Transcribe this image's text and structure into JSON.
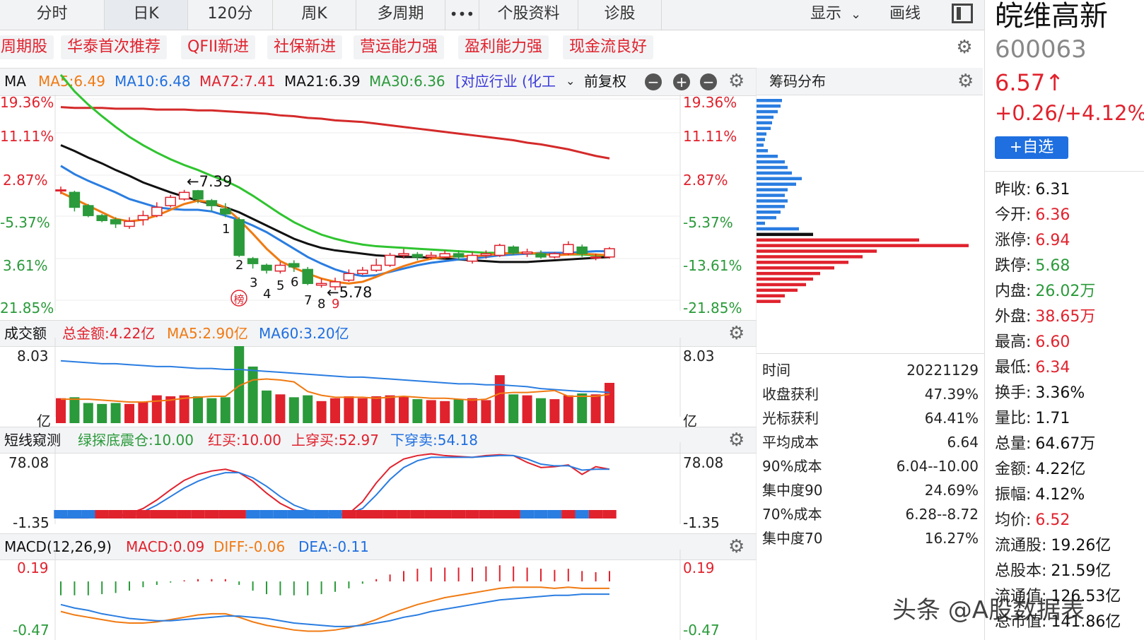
{
  "tabs": [
    "分时",
    "日K",
    "120分",
    "周K",
    "多周期",
    "•••",
    "个股资料",
    "诊股"
  ],
  "active_tab": "日K",
  "toolbar": {
    "show": "显示",
    "draw": "画线"
  },
  "tags": [
    "周期股",
    "华泰首次推荐",
    "QFII新进",
    "社保新进",
    "营运能力强",
    "盈利能力强",
    "现金流良好"
  ],
  "ma_header": {
    "label": "MA",
    "ma5": "MA5:6.49",
    "ma10": "MA10:6.48",
    "ma72": "MA72:7.41",
    "ma21": "MA21:6.39",
    "ma30": "MA30:6.36",
    "industry": "[对应行业 (化工",
    "adjust": "前复权"
  },
  "price_axis_left": [
    "19.36%",
    "11.11%",
    "2.87%",
    "-5.37%",
    "3.61%",
    "21.85%"
  ],
  "price_axis_right": [
    "19.36%",
    "11.11%",
    "2.87%",
    "-5.37%",
    "-13.61%",
    "-21.85%"
  ],
  "annotations": {
    "high": "←7.39",
    "low": "←5.78",
    "bang": "榜",
    "counts": [
      "1",
      "2",
      "3",
      "4",
      "5",
      "6",
      "7",
      "8",
      "9"
    ]
  },
  "volume_header": {
    "label": "成交额",
    "total": "总金额:4.22亿",
    "ma5": "MA5:2.90亿",
    "ma60": "MA60:3.20亿"
  },
  "volume_axis": {
    "top_left": "8.03",
    "bottom_left": "亿",
    "top_right": "8.03",
    "bottom_right": "亿"
  },
  "short_header": {
    "label": "短线窥测",
    "green": "绿探底震仓:10.00",
    "red": "红买:10.00",
    "up": "上穿买:52.97",
    "down": "下穿卖:54.18"
  },
  "short_axis": {
    "top_left": "78.08",
    "bottom_left": "-1.35",
    "top_right": "78.08",
    "bottom_right": "-1.35"
  },
  "macd_header": {
    "label": "MACD(12,26,9)",
    "macd": "MACD:0.09",
    "diff": "DIFF:-0.06",
    "dea": "DEA:-0.11"
  },
  "macd_axis": {
    "top_left": "0.19",
    "bottom_left": "-0.47",
    "top_right": "0.19",
    "bottom_right": "-0.47"
  },
  "chip": {
    "title": "筹码分布",
    "rows": [
      {
        "k": "时间",
        "v": "20221129"
      },
      {
        "k": "收盘获利",
        "v": "47.39%"
      },
      {
        "k": "光标获利",
        "v": "64.41%"
      },
      {
        "k": "平均成本",
        "v": "6.64"
      },
      {
        "k": "90%成本",
        "v": "6.04--10.00"
      },
      {
        "k": "集中度90",
        "v": "24.69%"
      },
      {
        "k": "70%成本",
        "v": "6.28--8.72"
      },
      {
        "k": "集中度70",
        "v": "16.27%"
      }
    ]
  },
  "quote": {
    "name": "皖维高新",
    "code": "600063",
    "price": "6.57↑",
    "change": "+0.26/+4.12%",
    "add_fav": "+自选",
    "rows": [
      {
        "k": "昨收:",
        "v": "6.31",
        "c": "black"
      },
      {
        "k": "今开:",
        "v": "6.36",
        "c": "red"
      },
      {
        "k": "涨停:",
        "v": "6.94",
        "c": "red"
      },
      {
        "k": "跌停:",
        "v": "5.68",
        "c": "green"
      },
      {
        "k": "内盘:",
        "v": "26.02万",
        "c": "green"
      },
      {
        "k": "外盘:",
        "v": "38.65万",
        "c": "red"
      },
      {
        "k": "最高:",
        "v": "6.60",
        "c": "red"
      },
      {
        "k": "最低:",
        "v": "6.34",
        "c": "red"
      },
      {
        "k": "换手:",
        "v": "3.36%",
        "c": "black"
      },
      {
        "k": "量比:",
        "v": "1.71",
        "c": "black"
      },
      {
        "k": "总量:",
        "v": "64.67万",
        "c": "black"
      },
      {
        "k": "金额:",
        "v": "4.22亿",
        "c": "black"
      },
      {
        "k": "振幅:",
        "v": "4.12%",
        "c": "black"
      },
      {
        "k": "均价:",
        "v": "6.52",
        "c": "red"
      },
      {
        "k": "流通股:",
        "v": "19.26亿",
        "c": "black"
      },
      {
        "k": "总股本:",
        "v": "21.59亿",
        "c": "black"
      },
      {
        "k": "流通值:",
        "v": "126.53亿",
        "c": "black"
      },
      {
        "k": "总市值:",
        "v": "141.86亿",
        "c": "black"
      }
    ]
  },
  "watermark": "头条 @A股数据表",
  "colors": {
    "up": "#e0222d",
    "down": "#2a9a3a",
    "ma5": "#f07a12",
    "ma10": "#2a7de1",
    "ma21": "#111111",
    "ma30": "#2fc42f",
    "ma72": "#d42a2a"
  },
  "chart_data": [
    {
      "type": "candlestick",
      "title": "",
      "candles": [
        {
          "o": 6.41,
          "c": 6.41,
          "h": 6.45,
          "l": 6.36
        },
        {
          "o": 6.38,
          "c": 6.2,
          "h": 6.4,
          "l": 6.15
        },
        {
          "o": 6.22,
          "c": 6.1,
          "h": 6.24,
          "l": 6.08
        },
        {
          "o": 6.1,
          "c": 6.04,
          "h": 6.12,
          "l": 6.02
        },
        {
          "o": 6.05,
          "c": 6.0,
          "h": 6.08,
          "l": 5.95
        },
        {
          "o": 5.97,
          "c": 6.03,
          "h": 6.08,
          "l": 5.94
        },
        {
          "o": 6.05,
          "c": 6.1,
          "h": 6.16,
          "l": 5.98
        },
        {
          "o": 6.1,
          "c": 6.2,
          "h": 6.26,
          "l": 6.08
        },
        {
          "o": 6.22,
          "c": 6.32,
          "h": 6.35,
          "l": 6.2
        },
        {
          "o": 6.3,
          "c": 6.38,
          "h": 6.41,
          "l": 6.28
        },
        {
          "o": 6.4,
          "c": 6.3,
          "h": 6.41,
          "l": 6.25
        },
        {
          "o": 6.28,
          "c": 6.22,
          "h": 6.3,
          "l": 6.15
        },
        {
          "o": 6.18,
          "c": 6.12,
          "h": 6.25,
          "l": 6.08
        },
        {
          "o": 6.05,
          "c": 5.62,
          "h": 6.08,
          "l": 5.6
        },
        {
          "o": 5.58,
          "c": 5.52,
          "h": 5.6,
          "l": 5.46
        },
        {
          "o": 5.5,
          "c": 5.44,
          "h": 5.52,
          "l": 5.4
        },
        {
          "o": 5.43,
          "c": 5.5,
          "h": 5.54,
          "l": 5.4
        },
        {
          "o": 5.52,
          "c": 5.48,
          "h": 5.56,
          "l": 5.42
        },
        {
          "o": 5.45,
          "c": 5.28,
          "h": 5.48,
          "l": 5.26
        },
        {
          "o": 5.26,
          "c": 5.28,
          "h": 5.34,
          "l": 5.23
        },
        {
          "o": 5.24,
          "c": 5.3,
          "h": 5.35,
          "l": 5.2
        },
        {
          "o": 5.32,
          "c": 5.4,
          "h": 5.45,
          "l": 5.3
        },
        {
          "o": 5.4,
          "c": 5.44,
          "h": 5.48,
          "l": 5.38
        },
        {
          "o": 5.44,
          "c": 5.5,
          "h": 5.58,
          "l": 5.42
        },
        {
          "o": 5.5,
          "c": 5.62,
          "h": 5.65,
          "l": 5.48
        },
        {
          "o": 5.62,
          "c": 5.64,
          "h": 5.7,
          "l": 5.58
        },
        {
          "o": 5.63,
          "c": 5.6,
          "h": 5.66,
          "l": 5.56
        },
        {
          "o": 5.6,
          "c": 5.62,
          "h": 5.66,
          "l": 5.57
        },
        {
          "o": 5.6,
          "c": 5.64,
          "h": 5.68,
          "l": 5.58
        },
        {
          "o": 5.64,
          "c": 5.6,
          "h": 5.68,
          "l": 5.56
        },
        {
          "o": 5.55,
          "c": 5.62,
          "h": 5.66,
          "l": 5.52
        },
        {
          "o": 5.62,
          "c": 5.64,
          "h": 5.68,
          "l": 5.58
        },
        {
          "o": 5.62,
          "c": 5.74,
          "h": 5.76,
          "l": 5.6
        },
        {
          "o": 5.72,
          "c": 5.65,
          "h": 5.74,
          "l": 5.62
        },
        {
          "o": 5.64,
          "c": 5.66,
          "h": 5.7,
          "l": 5.6
        },
        {
          "o": 5.64,
          "c": 5.6,
          "h": 5.68,
          "l": 5.58
        },
        {
          "o": 5.6,
          "c": 5.64,
          "h": 5.66,
          "l": 5.58
        },
        {
          "o": 5.64,
          "c": 5.75,
          "h": 5.79,
          "l": 5.62
        },
        {
          "o": 5.72,
          "c": 5.64,
          "h": 5.75,
          "l": 5.6
        },
        {
          "o": 5.6,
          "c": 5.6,
          "h": 5.64,
          "l": 5.56
        },
        {
          "o": 5.6,
          "c": 5.7,
          "h": 5.72,
          "l": 5.58
        }
      ],
      "ma": {
        "ma5": [
          6.38,
          6.3,
          6.22,
          6.14,
          6.06,
          6.03,
          6.05,
          6.1,
          6.17,
          6.24,
          6.28,
          6.26,
          6.2,
          6.05,
          5.88,
          5.7,
          5.55,
          5.47,
          5.4,
          5.34,
          5.3,
          5.28,
          5.3,
          5.36,
          5.43,
          5.49,
          5.54,
          5.58,
          5.6,
          5.61,
          5.61,
          5.62,
          5.64,
          5.65,
          5.65,
          5.64,
          5.62,
          5.63,
          5.64,
          5.63,
          5.62
        ],
        "ma10": [
          6.7,
          6.6,
          6.52,
          6.45,
          6.38,
          6.3,
          6.25,
          6.2,
          6.18,
          6.17,
          6.17,
          6.15,
          6.1,
          6.05,
          5.98,
          5.9,
          5.8,
          5.7,
          5.6,
          5.52,
          5.45,
          5.4,
          5.37,
          5.38,
          5.42,
          5.46,
          5.5,
          5.53,
          5.55,
          5.57,
          5.58,
          5.6,
          5.62,
          5.63,
          5.64,
          5.65,
          5.65,
          5.65,
          5.66,
          5.67,
          5.67
        ],
        "ma21": [
          6.95,
          6.88,
          6.8,
          6.73,
          6.65,
          6.58,
          6.5,
          6.44,
          6.38,
          6.33,
          6.28,
          6.24,
          6.2,
          6.14,
          6.06,
          5.98,
          5.9,
          5.82,
          5.76,
          5.71,
          5.68,
          5.66,
          5.64,
          5.62,
          5.61,
          5.6,
          5.6,
          5.59,
          5.58,
          5.57,
          5.56,
          5.55,
          5.54,
          5.54,
          5.54,
          5.55,
          5.56,
          5.57,
          5.58,
          5.59,
          5.6
        ],
        "ma30": [
          7.8,
          7.6,
          7.44,
          7.3,
          7.17,
          7.05,
          6.95,
          6.86,
          6.78,
          6.71,
          6.65,
          6.58,
          6.52,
          6.44,
          6.34,
          6.23,
          6.12,
          6.02,
          5.94,
          5.87,
          5.82,
          5.78,
          5.75,
          5.73,
          5.72,
          5.71,
          5.7,
          5.69,
          5.68,
          5.67,
          5.66,
          5.65,
          5.65,
          5.64,
          5.64,
          5.64,
          5.63,
          5.63,
          5.63,
          5.62,
          5.62
        ],
        "ma72": [
          7.41,
          7.4,
          7.4,
          7.4,
          7.39,
          7.39,
          7.39,
          7.38,
          7.38,
          7.38,
          7.37,
          7.37,
          7.36,
          7.35,
          7.34,
          7.33,
          7.31,
          7.3,
          7.28,
          7.27,
          7.25,
          7.24,
          7.23,
          7.21,
          7.19,
          7.17,
          7.15,
          7.13,
          7.11,
          7.09,
          7.07,
          7.05,
          7.03,
          7.01,
          6.98,
          6.96,
          6.93,
          6.9,
          6.86,
          6.82,
          6.79
        ]
      },
      "ylim": [
        4.95,
        7.56
      ]
    },
    {
      "type": "bar",
      "title": "成交额",
      "values": [
        2.6,
        2.7,
        2.1,
        2.0,
        2.1,
        2.0,
        2.2,
        2.9,
        2.8,
        2.9,
        2.8,
        2.6,
        2.7,
        8.03,
        5.9,
        3.4,
        3.0,
        2.7,
        2.9,
        2.3,
        2.6,
        2.8,
        2.6,
        2.8,
        2.9,
        2.8,
        2.5,
        2.4,
        2.3,
        2.5,
        2.6,
        2.4,
        5.0,
        3.0,
        2.9,
        2.6,
        2.5,
        2.9,
        3.1,
        3.0,
        4.2
      ],
      "ma5": [
        2.5,
        2.5,
        2.5,
        2.4,
        2.3,
        2.2,
        2.2,
        2.3,
        2.4,
        2.6,
        2.7,
        2.8,
        2.8,
        3.9,
        4.5,
        4.6,
        4.5,
        4.3,
        3.3,
        2.9,
        2.7,
        2.7,
        2.7,
        2.6,
        2.7,
        2.8,
        2.7,
        2.6,
        2.6,
        2.5,
        2.4,
        2.5,
        3.1,
        3.2,
        3.2,
        3.3,
        3.4,
        2.8,
        2.8,
        2.8,
        3.0
      ],
      "ma60": [
        6.5,
        6.4,
        6.3,
        6.2,
        6.2,
        6.1,
        6.0,
        5.9,
        5.9,
        5.8,
        5.7,
        5.7,
        5.6,
        5.6,
        5.5,
        5.4,
        5.3,
        5.2,
        5.1,
        5.0,
        4.9,
        4.8,
        4.8,
        4.7,
        4.6,
        4.5,
        4.4,
        4.3,
        4.2,
        4.1,
        4.1,
        4.0,
        4.0,
        3.9,
        3.8,
        3.6,
        3.5,
        3.4,
        3.3,
        3.3,
        3.2
      ],
      "ylim": [
        0,
        8.03
      ]
    },
    {
      "type": "line",
      "title": "短线窥测",
      "series": [
        {
          "name": "红",
          "values": [
            1,
            1,
            1,
            2,
            3,
            6,
            12,
            22,
            34,
            45,
            52,
            56,
            58,
            54,
            44,
            30,
            18,
            10,
            6,
            4,
            3,
            6,
            20,
            42,
            60,
            70,
            74,
            76,
            74,
            73,
            72,
            74,
            75,
            74,
            66,
            60,
            61,
            63,
            52,
            61,
            58
          ]
        },
        {
          "name": "蓝",
          "values": [
            3,
            2,
            2,
            2,
            2,
            4,
            8,
            16,
            26,
            36,
            44,
            50,
            54,
            54,
            48,
            38,
            26,
            16,
            10,
            7,
            5,
            6,
            12,
            28,
            46,
            60,
            68,
            72,
            72,
            72,
            72,
            73,
            74,
            74,
            70,
            64,
            62,
            62,
            57,
            58,
            58
          ]
        }
      ],
      "ylim": [
        -1.35,
        78.08
      ]
    },
    {
      "type": "bar",
      "title": "MACD(12,26,9)",
      "values": [
        -0.12,
        -0.12,
        -0.12,
        -0.11,
        -0.1,
        -0.08,
        -0.05,
        -0.03,
        -0.01,
        0.01,
        0.02,
        0.02,
        0.02,
        -0.03,
        -0.08,
        -0.11,
        -0.12,
        -0.12,
        -0.12,
        -0.11,
        -0.09,
        -0.06,
        -0.02,
        0.02,
        0.06,
        0.09,
        0.11,
        0.12,
        0.12,
        0.12,
        0.12,
        0.13,
        0.14,
        0.13,
        0.12,
        0.11,
        0.1,
        0.11,
        0.09,
        0.08,
        0.09
      ],
      "diff": [
        -0.26,
        -0.29,
        -0.31,
        -0.33,
        -0.35,
        -0.36,
        -0.36,
        -0.35,
        -0.33,
        -0.31,
        -0.29,
        -0.28,
        -0.28,
        -0.31,
        -0.35,
        -0.38,
        -0.4,
        -0.42,
        -0.43,
        -0.43,
        -0.42,
        -0.4,
        -0.37,
        -0.33,
        -0.28,
        -0.24,
        -0.2,
        -0.17,
        -0.14,
        -0.12,
        -0.1,
        -0.08,
        -0.06,
        -0.05,
        -0.05,
        -0.05,
        -0.06,
        -0.05,
        -0.06,
        -0.06,
        -0.06
      ],
      "dea": [
        -0.2,
        -0.23,
        -0.25,
        -0.28,
        -0.3,
        -0.32,
        -0.33,
        -0.34,
        -0.34,
        -0.33,
        -0.32,
        -0.31,
        -0.3,
        -0.3,
        -0.31,
        -0.32,
        -0.34,
        -0.36,
        -0.37,
        -0.38,
        -0.39,
        -0.39,
        -0.38,
        -0.36,
        -0.34,
        -0.31,
        -0.29,
        -0.26,
        -0.24,
        -0.22,
        -0.2,
        -0.18,
        -0.16,
        -0.15,
        -0.14,
        -0.13,
        -0.12,
        -0.12,
        -0.11,
        -0.11,
        -0.11
      ],
      "ylim": [
        -0.47,
        0.19
      ]
    }
  ]
}
